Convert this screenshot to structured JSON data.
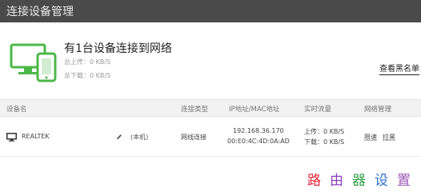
{
  "window": {
    "title": "连接设备管理"
  },
  "summary": {
    "headline": "有1台设备连接到网络",
    "upload_total": "总上传：0 KB/S",
    "download_total": "总下载：0 KB/S",
    "blacklist_link": "查看黑名单",
    "icon": "devices-icon",
    "accent_color": "#4cb848"
  },
  "table": {
    "headers": {
      "device_name": "设备名",
      "connection_type": "连接类型",
      "ip_mac": "IP地址/MAC地址",
      "realtime_traffic": "实时流量",
      "network_mgmt": "网络管理"
    },
    "rows": [
      {
        "device_icon": "pc-icon",
        "device_name": "REALTEK",
        "edit_icon": "pencil-icon",
        "tag": "(本机)",
        "connection_type": "网线连接",
        "ip": "192.168.36.170",
        "mac": "00:E0:4C:4D:0A:AD",
        "upload": "上传：0 KB/S",
        "download": "下载：0 KB/S",
        "actions": [
          "限速",
          "拉黑"
        ]
      }
    ]
  },
  "watermark": {
    "chars": [
      "路",
      "由",
      "器",
      "设",
      "置"
    ],
    "colors": [
      "#e8253a",
      "#8e3fbf",
      "#2f9e44",
      "#2f6fd6",
      "#9b59b6"
    ]
  }
}
